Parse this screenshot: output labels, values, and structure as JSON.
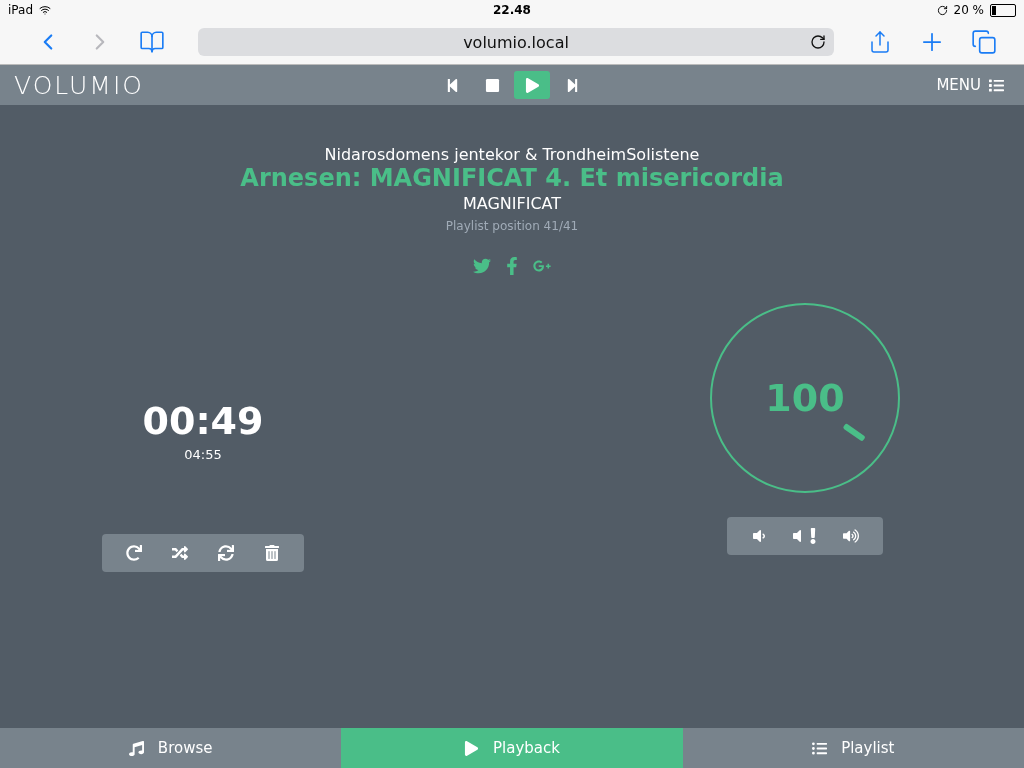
{
  "status_bar": {
    "device": "iPad",
    "time": "22.48",
    "battery": "20 %"
  },
  "browser": {
    "url": "volumio.local"
  },
  "header": {
    "logo": "VOLUMIO",
    "menu": "MENU",
    "transport": [
      {
        "kind": "previous",
        "selected": false
      },
      {
        "kind": "stop",
        "selected": false
      },
      {
        "kind": "play",
        "selected": true
      },
      {
        "kind": "next",
        "selected": false
      }
    ]
  },
  "track": {
    "artist": "Nidarosdomens jentekor & TrondheimSolistene",
    "title": "Arnesen: MAGNIFICAT 4. Et misericordia",
    "album": "MAGNIFICAT",
    "position": "Playlist position 41/41"
  },
  "time": {
    "elapsed": "00:49",
    "total": "04:55"
  },
  "volume": {
    "value": "100"
  },
  "tabs": [
    {
      "kind": "browse",
      "label": "Browse",
      "selected": false
    },
    {
      "kind": "playback",
      "label": "Playback",
      "selected": true
    },
    {
      "kind": "playlist",
      "label": "Playlist",
      "selected": false
    }
  ]
}
